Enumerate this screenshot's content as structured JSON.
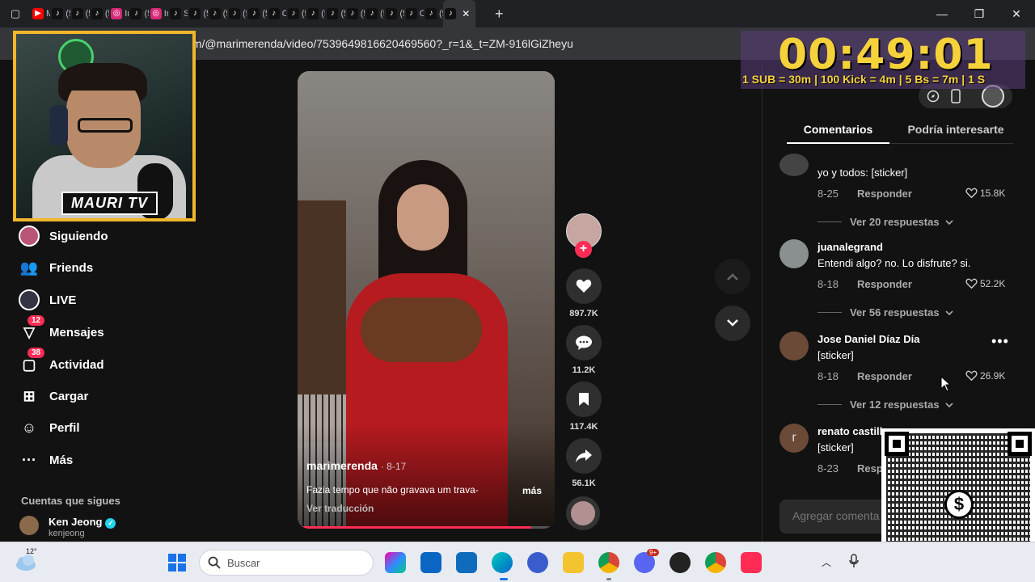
{
  "browser": {
    "tabs": [
      {
        "label": "MI",
        "icon": "youtube-icon",
        "color": "#ff0000"
      },
      {
        "label": "(5(",
        "icon": "tiktok-icon",
        "color": "#111111"
      },
      {
        "label": "(5(",
        "icon": "tiktok-icon",
        "color": "#111111"
      },
      {
        "label": "(5(",
        "icon": "tiktok-icon",
        "color": "#111111"
      },
      {
        "label": "Ins",
        "icon": "instagram-icon",
        "color": "#d62976"
      },
      {
        "label": "(5(",
        "icon": "tiktok-icon",
        "color": "#111111"
      },
      {
        "label": "Ins",
        "icon": "instagram-icon",
        "color": "#d62976"
      },
      {
        "label": "Si,",
        "icon": "tiktok-icon",
        "color": "#111111"
      },
      {
        "label": "(5(",
        "icon": "tiktok-icon",
        "color": "#111111"
      },
      {
        "label": "(5(",
        "icon": "tiktok-icon",
        "color": "#111111"
      },
      {
        "label": "(5(",
        "icon": "tiktok-icon",
        "color": "#111111"
      },
      {
        "label": "(5(",
        "icon": "tiktok-icon",
        "color": "#111111"
      },
      {
        "label": "Co",
        "icon": "tiktok-icon",
        "color": "#111111"
      },
      {
        "label": "(5(",
        "icon": "tiktok-icon",
        "color": "#111111"
      },
      {
        "label": "(5(",
        "icon": "tiktok-icon",
        "color": "#111111"
      },
      {
        "label": "(5(",
        "icon": "tiktok-icon",
        "color": "#111111"
      },
      {
        "label": "(5(",
        "icon": "tiktok-icon",
        "color": "#111111"
      },
      {
        "label": "(5(",
        "icon": "tiktok-icon",
        "color": "#111111"
      },
      {
        "label": "(5(",
        "icon": "tiktok-icon",
        "color": "#111111"
      },
      {
        "label": "Ca",
        "icon": "tiktok-icon",
        "color": "#111111"
      },
      {
        "label": "(5(",
        "icon": "tiktok-icon",
        "color": "#111111"
      }
    ],
    "url": "om/@marimerenda/video/7539649816620469560?_r=1&_t=ZM-916lGiZheyu"
  },
  "overlay": {
    "timer": "00:49:01",
    "subathon_rules": "1 SUB = 30m | 100 Kick = 4m | 5 Bs = 7m | 1 S",
    "brand": "MAURI TV"
  },
  "sidebar": {
    "items": [
      {
        "label": "Siguiendo",
        "icon": "following-avatar-icon",
        "badge": ""
      },
      {
        "label": "Friends",
        "icon": "friends-icon",
        "badge": ""
      },
      {
        "label": "LIVE",
        "icon": "live-icon",
        "badge": ""
      },
      {
        "label": "Mensajes",
        "icon": "messages-icon",
        "badge": "12"
      },
      {
        "label": "Actividad",
        "icon": "activity-icon",
        "badge": "38"
      },
      {
        "label": "Cargar",
        "icon": "upload-icon",
        "badge": ""
      },
      {
        "label": "Perfil",
        "icon": "profile-icon",
        "badge": ""
      },
      {
        "label": "Más",
        "icon": "more-icon",
        "badge": ""
      }
    ],
    "following_label": "Cuentas que sigues",
    "followed": {
      "name": "Ken Jeong",
      "handle": "kenjeong"
    }
  },
  "video": {
    "author": "marimerenda",
    "date": "· 8-17",
    "caption": "Fazia tempo que não gravava um trava-",
    "more": "más",
    "translate": "Ver traducción",
    "progress": 0.91
  },
  "actions": {
    "likes": "897.7K",
    "comments": "11.2K",
    "saves": "117.4K",
    "shares": "56.1K"
  },
  "panel": {
    "tab_comments": "Comentarios",
    "tab_interest": "Podría interesarte",
    "comments": [
      {
        "name": "",
        "text": "yo y todos: [sticker]",
        "date": "8-25",
        "reply": "Responder",
        "likes": "15.8K",
        "replies": "Ver 20 respuestas"
      },
      {
        "name": "juanalegrand",
        "text": "Entendi algo? no. Lo disfrute? si.",
        "date": "8-18",
        "reply": "Responder",
        "likes": "52.2K",
        "replies": "Ver 56 respuestas"
      },
      {
        "name": "Jose Daniel Díaz Día",
        "text": "[sticker]",
        "date": "8-18",
        "reply": "Responder",
        "likes": "26.9K",
        "replies": "Ver 12 respuestas"
      },
      {
        "name": "renato castill",
        "text": "[sticker]",
        "date": "8-23",
        "reply": "Resp",
        "likes": "",
        "replies": "",
        "avatar_letter": "r"
      }
    ],
    "add_comment_placeholder": "Agregar comenta"
  },
  "taskbar": {
    "temperature": "12°",
    "search_placeholder": "Buscar",
    "messenger_badge": "9+"
  },
  "colors": {
    "accent": "#fe2c55",
    "timer": "#f6d23a",
    "cam_border": "#f2b62a"
  }
}
